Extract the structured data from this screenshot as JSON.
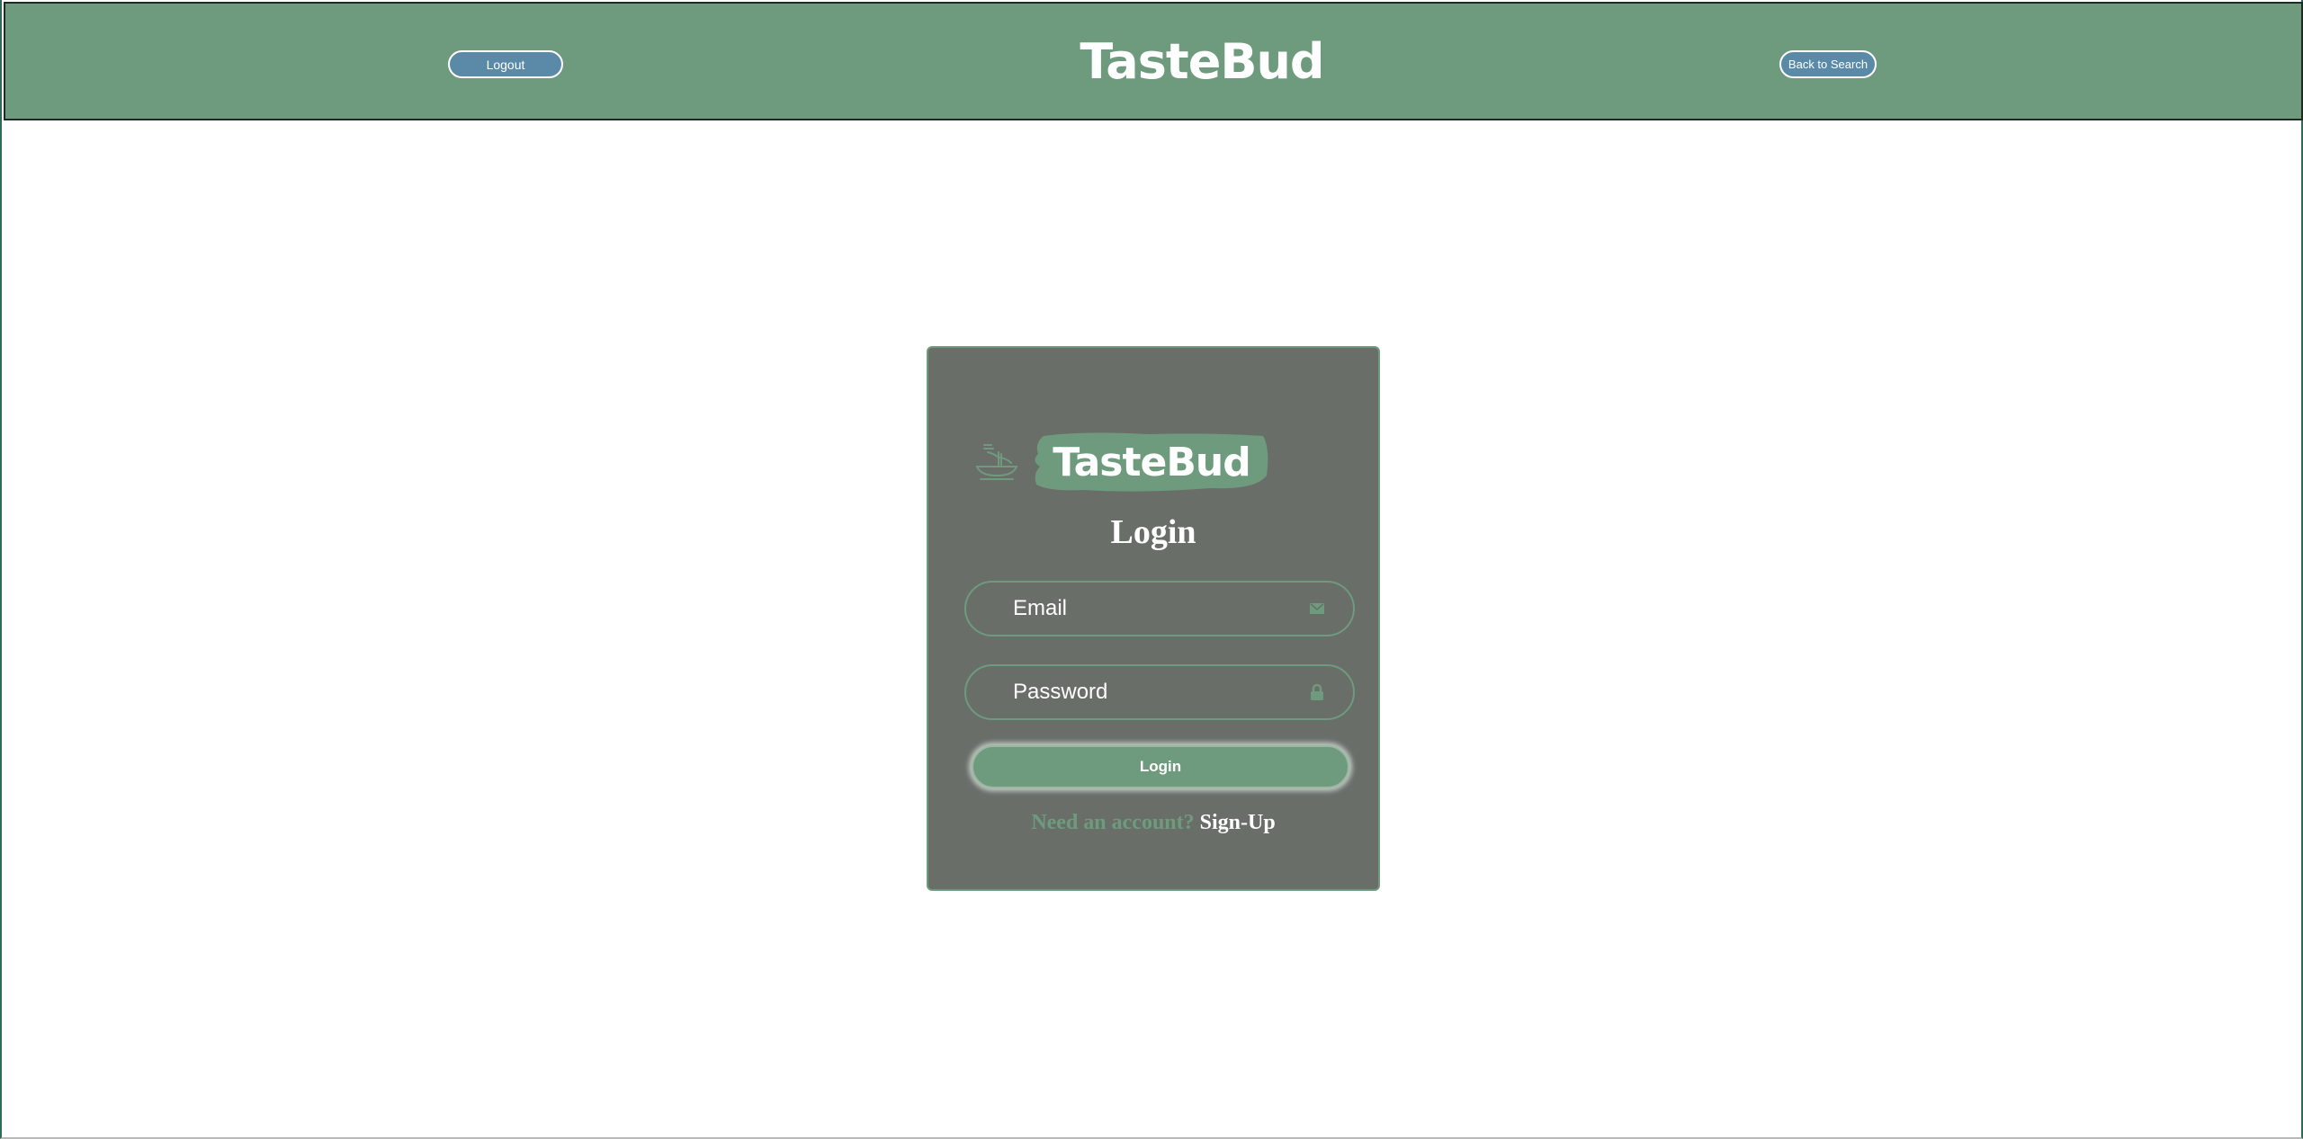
{
  "header": {
    "logout_label": "Logout",
    "brand": "TasteBud",
    "back_label": "Back to Search"
  },
  "login_card": {
    "brand": "TasteBud",
    "title": "Login",
    "email_placeholder": "Email",
    "password_placeholder": "Password",
    "submit_label": "Login",
    "need_account_text": "Need an account?",
    "signup_label": "Sign-Up"
  },
  "icons": {
    "logo": "noodle-bowl-icon",
    "email": "envelope-icon",
    "password": "lock-icon"
  },
  "colors": {
    "brand_green": "#6e9b7d",
    "card_gray": "#696e69",
    "button_blue": "#5b8aa8",
    "text_white": "#ffffff"
  }
}
